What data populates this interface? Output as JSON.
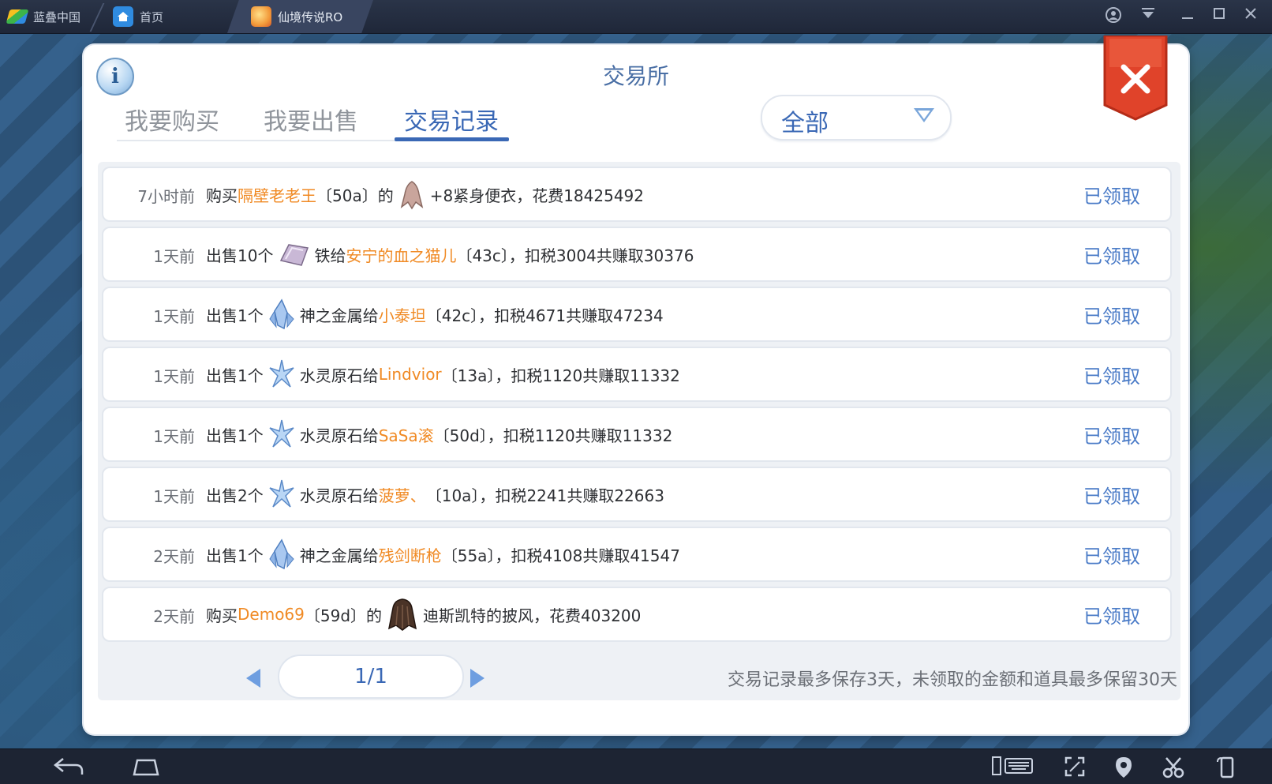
{
  "emulator": {
    "brand_label": "蓝叠中国",
    "tabs": [
      {
        "label": "首页"
      },
      {
        "label": "仙境传说RO"
      }
    ]
  },
  "dialog": {
    "title": "交易所",
    "tabs": [
      {
        "label": "我要购买",
        "active": false
      },
      {
        "label": "我要出售",
        "active": false
      },
      {
        "label": "交易记录",
        "active": true
      }
    ],
    "filter": {
      "selected": "全部"
    }
  },
  "records": [
    {
      "time": "7小时前",
      "pre": "购买",
      "name": "隔壁老老王",
      "mid": "〔50a〕的",
      "icon": "cloth-icon",
      "post": "+8紧身便衣，花费18425492",
      "status": "已领取"
    },
    {
      "time": "1天前",
      "pre": "出售10个",
      "name": "",
      "mid": "",
      "icon": "iron-ingot-icon",
      "post_before_name": "铁给",
      "name2": "安宁的血之猫儿",
      "post": "〔43c〕，扣税3004共赚取30376",
      "status": "已领取"
    },
    {
      "time": "1天前",
      "pre": "出售1个",
      "icon": "crystal-icon",
      "post_before_name": "神之金属给",
      "name2": "小泰坦",
      "post": "〔42c〕，扣税4671共赚取47234",
      "status": "已领取"
    },
    {
      "time": "1天前",
      "pre": "出售1个",
      "icon": "water-stone-icon",
      "post_before_name": "水灵原石给",
      "name2": "Lindvior",
      "post": "〔13a〕，扣税1120共赚取11332",
      "status": "已领取"
    },
    {
      "time": "1天前",
      "pre": "出售1个",
      "icon": "water-stone-icon",
      "post_before_name": "水灵原石给",
      "name2": "SaSa滚",
      "post": "〔50d〕，扣税1120共赚取11332",
      "status": "已领取"
    },
    {
      "time": "1天前",
      "pre": "出售2个",
      "icon": "water-stone-icon",
      "post_before_name": "水灵原石给",
      "name2": "菠萝、",
      "post": "〔10a〕，扣税2241共赚取22663",
      "status": "已领取"
    },
    {
      "time": "2天前",
      "pre": "出售1个",
      "icon": "crystal-icon",
      "post_before_name": "神之金属给",
      "name2": "残剑断枪",
      "post": "〔55a〕，扣税4108共赚取41547",
      "status": "已领取"
    },
    {
      "time": "2天前",
      "pre": "购买",
      "name": "Demo69",
      "mid": "〔59d〕的",
      "icon": "cape-icon",
      "post": "迪斯凯特的披风，花费403200",
      "status": "已领取"
    }
  ],
  "pager": {
    "page_text": "1/1"
  },
  "footnote": "交易记录最多保存3天，未领取的金额和道具最多保留30天",
  "colors": {
    "accent": "#3a68b5",
    "name": "#f08a24",
    "status": "#4a7bc7",
    "close": "#e0432a"
  }
}
